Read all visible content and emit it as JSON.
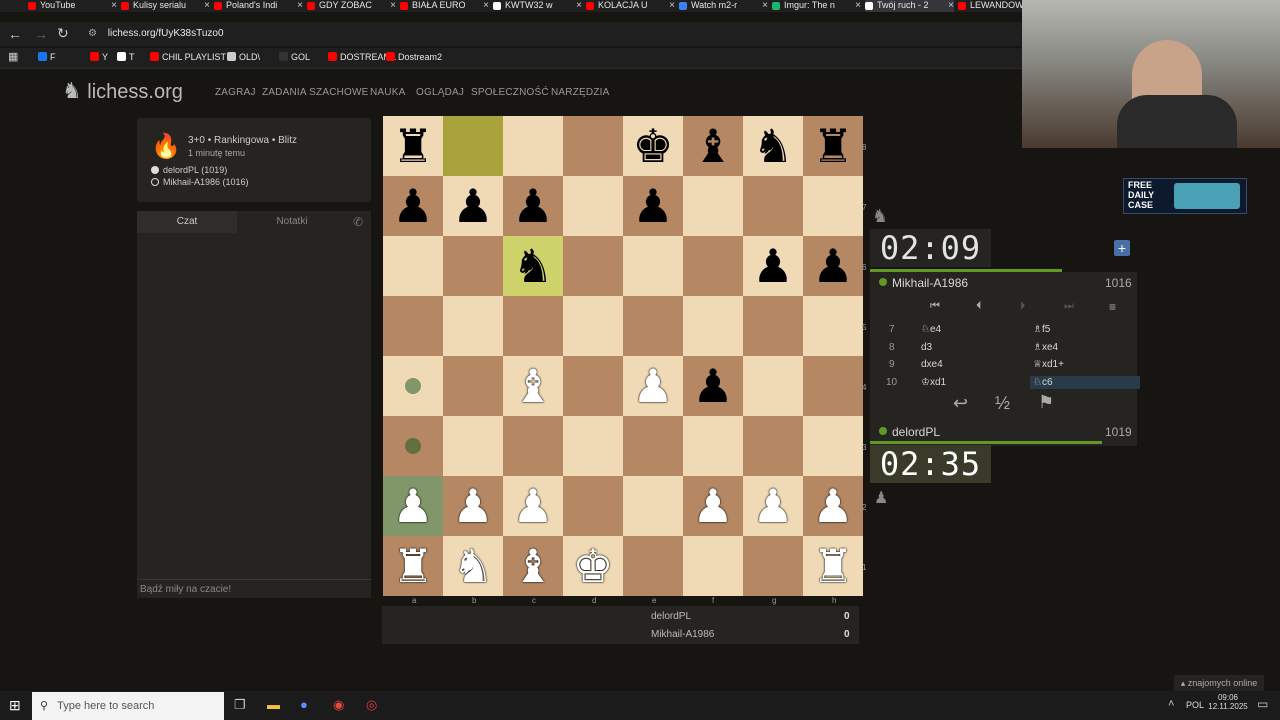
{
  "browser": {
    "tabs": [
      {
        "label": "YouTube",
        "color": "#ff0000"
      },
      {
        "label": "Kulisy serialu",
        "color": "#ff0000"
      },
      {
        "label": "Poland's Indi",
        "color": "#ff0000"
      },
      {
        "label": "GDY ZOBAC",
        "color": "#ff0000"
      },
      {
        "label": "BIAŁA EURO",
        "color": "#ff0000"
      },
      {
        "label": "KWTW32 w",
        "color": "#ffffff"
      },
      {
        "label": "KOLACJA U",
        "color": "#ff0000"
      },
      {
        "label": "Watch m2-r",
        "color": "#3b82f6"
      },
      {
        "label": "Imgur: The n",
        "color": "#1bb76e"
      },
      {
        "label": "Twój ruch - 2",
        "color": "#ffffff"
      },
      {
        "label": "LEWANDOW",
        "color": "#ff0000"
      }
    ],
    "url": "lichess.org/fUyK38sTuzo0",
    "bookmarks": [
      "F",
      "Y",
      "T",
      "CHIL PLAYLIST",
      "OLD\\",
      "GOL",
      "DOSTREAM1",
      "Dostream2"
    ]
  },
  "site": {
    "logo": "lichess.org",
    "nav": [
      "ZAGRAJ",
      "ZADANIA SZACHOWE",
      "NAUKA",
      "OGLĄDAJ",
      "SPOŁECZNOŚĆ",
      "NARZĘDZIA"
    ]
  },
  "game_info": {
    "mode": "3+0 • Rankingowa • Blitz",
    "time_ago": "1 minutę temu",
    "white": "delordPL (1019)",
    "black": "Mikhail-A1986 (1016)"
  },
  "chat": {
    "tab_chat": "Czat",
    "tab_notes": "Notatki",
    "placeholder": "Bądź miły na czacie!"
  },
  "board": {
    "files": [
      "a",
      "b",
      "c",
      "d",
      "e",
      "f",
      "g",
      "h"
    ],
    "ranks": [
      "8",
      "7",
      "6",
      "5",
      "4",
      "3",
      "2",
      "1"
    ],
    "position": [
      "r...kbnr",
      "ppp.p...",
      "..n...pp",
      "........",
      "..B.Pp..",
      "........",
      "PPP..PPP",
      "RNBK...R"
    ],
    "last_move": [
      "b8",
      "c6"
    ],
    "selected": "a2",
    "move_hints": [
      "a4",
      "a3"
    ]
  },
  "opponent": {
    "name": "Mikhail-A1986",
    "rating": "1016",
    "clock": "02:09"
  },
  "player": {
    "name": "delordPL",
    "rating": "1019",
    "clock": "02:35"
  },
  "moves": [
    {
      "n": "7",
      "w": "♘e4",
      "b": "♗f5"
    },
    {
      "n": "8",
      "w": "d3",
      "b": "♗xe4"
    },
    {
      "n": "9",
      "w": "dxe4",
      "b": "♕xd1+"
    },
    {
      "n": "10",
      "w": "♔xd1",
      "b": "♘c6"
    }
  ],
  "scores": [
    {
      "name": "delordPL",
      "value": "0"
    },
    {
      "name": "Mikhail-A1986",
      "value": "0"
    }
  ],
  "overlay": {
    "ad_line1": "FREE",
    "ad_line2": "DAILY",
    "ad_line3": "CASE"
  },
  "taskbar": {
    "search_placeholder": "Type here to search",
    "lang": "POL",
    "time": "09:06",
    "date": "12.11.2025",
    "online": "znajomych online"
  }
}
